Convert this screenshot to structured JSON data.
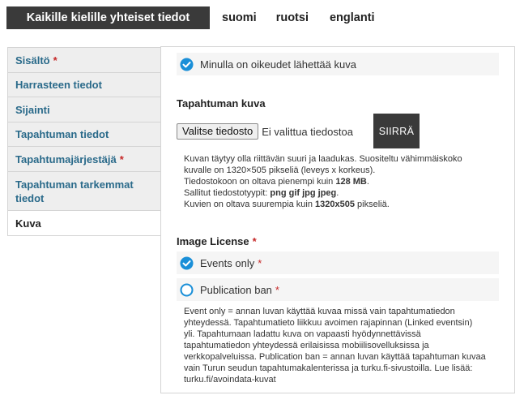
{
  "top_tabs": [
    {
      "label": "Kaikille kielille yhteiset tiedot"
    },
    {
      "label": "suomi"
    },
    {
      "label": "ruotsi"
    },
    {
      "label": "englanti"
    }
  ],
  "side_tabs": [
    {
      "label": "Sisältö",
      "required": "*"
    },
    {
      "label": "Harrasteen tiedot"
    },
    {
      "label": "Sijainti"
    },
    {
      "label": "Tapahtuman tiedot"
    },
    {
      "label": "Tapahtumajärjestäjä",
      "required": "*"
    },
    {
      "label": "Tapahtuman tarkemmat tiedot"
    },
    {
      "label": "Kuva"
    }
  ],
  "rights_checkbox": {
    "label": "Minulla on oikeudet lähettää kuva",
    "checked": true
  },
  "image_section": {
    "title": "Tapahtuman kuva",
    "choose_button": "Valitse tiedosto",
    "no_file_text": "Ei valittua tiedostoa",
    "upload_button": "SIIRRÄ",
    "help": {
      "line1": "Kuvan täytyy olla riittävän suuri ja laadukas. Suositeltu vähimmäiskoko",
      "line2": "kuvalle on 1320×505 pikseliä (leveys x korkeus).",
      "line3_pre": "Tiedostokoon on oltava pienempi kuin ",
      "line3_bold": "128 MB",
      "line3_post": ".",
      "line4_pre": "Sallitut tiedostotyypit: ",
      "line4_bold": "png gif jpg jpeg",
      "line4_post": ".",
      "line5_pre": "Kuvien on oltava suurempia kuin ",
      "line5_bold": "1320x505",
      "line5_post": " pikseliä."
    }
  },
  "license": {
    "title": "Image License",
    "required": "*",
    "options": [
      {
        "label": "Events only",
        "required": "*",
        "selected": true
      },
      {
        "label": "Publication ban",
        "required": "*",
        "selected": false
      }
    ],
    "help_lines": [
      "Event only = annan luvan käyttää kuvaa missä vain tapahtumatiedon",
      "yhteydessä. Tapahtumatieto liikkuu avoimen rajapinnan (Linked eventsin)",
      "yli. Tapahtumaan ladattu kuva on vapaasti hyödynnettävissä",
      "tapahtumatiedon yhteydessä erilaisissa mobiilisovelluksissa ja",
      "verkkopalveluissa. Publication ban = annan luvan käyttää tapahtuman kuvaa",
      "vain Turun seudun tapahtumakalenterissa ja turku.fi-sivustoilla. Lue lisää:",
      "turku.fi/avoindata-kuvat"
    ]
  },
  "colors": {
    "accent": "#1a8fd8",
    "required": "#c62828",
    "tab_link": "#2a6a8a",
    "dark": "#3a3a3a"
  }
}
